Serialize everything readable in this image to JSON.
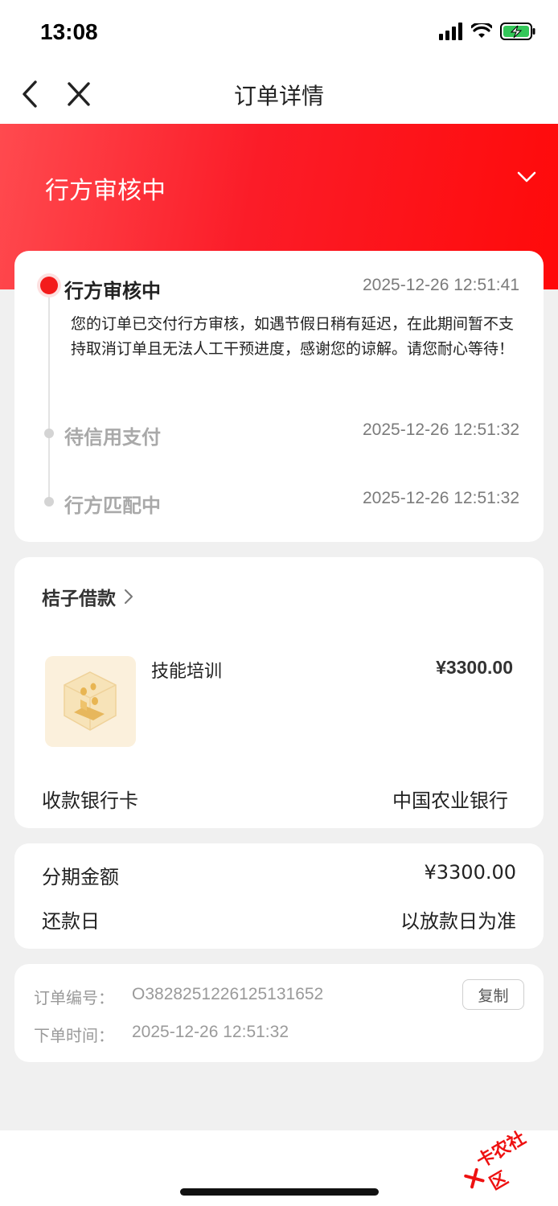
{
  "status_bar": {
    "time": "13:08"
  },
  "nav": {
    "title": "订单详情"
  },
  "hero": {
    "status": "行方审核中"
  },
  "timeline": [
    {
      "status": "行方审核中",
      "time": "2025-12-26 12:51:41",
      "description": "您的订单已交付行方审核，如遇节假日稍有延迟，在此期间暂不支持取消订单且无法人工干预进度，感谢您的谅解。请您耐心等待！"
    },
    {
      "status": "待信用支付",
      "time": "2025-12-26 12:51:32"
    },
    {
      "status": "行方匹配中",
      "time": "2025-12-26 12:51:32"
    }
  ],
  "product": {
    "merchant": "桔子借款",
    "name": "技能培训",
    "price": "¥3300.00",
    "bank_label": "收款银行卡",
    "bank_value": "中国农业银行"
  },
  "installment": {
    "amount_label": "分期金额",
    "amount_value": "¥3300.00",
    "repay_label": "还款日",
    "repay_value": "以放款日为准"
  },
  "order": {
    "number_label": "订单编号：",
    "number_value": "O3828251226125131652",
    "copy_label": "复制",
    "time_label": "下单时间：",
    "time_value": "2025-12-26 12:51:32"
  },
  "watermark": {
    "text": "卡农社区"
  },
  "colors": {
    "accent": "#f31b1b",
    "hero_start": "#ff4a4f",
    "hero_end": "#ff0a0a"
  }
}
